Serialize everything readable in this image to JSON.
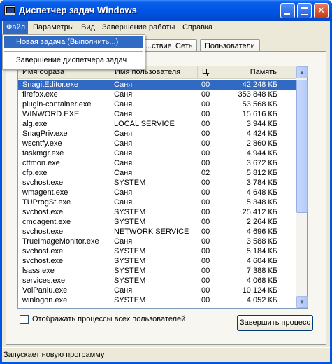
{
  "window": {
    "title": "Диспетчер задач Windows"
  },
  "menu": {
    "items": [
      "Файл",
      "Параметры",
      "Вид",
      "Завершение работы",
      "Справка"
    ],
    "file_dropdown": [
      "Новая задача (Выполнить...)",
      "Завершение диспетчера задач"
    ]
  },
  "tabs": [
    "...ствие",
    "Сеть",
    "Пользователи"
  ],
  "processes": {
    "columns": [
      "Имя образа",
      "Имя пользователя",
      "Ц.",
      "Память"
    ],
    "rows": [
      {
        "name": "SnagitEditor.exe",
        "user": "Саня",
        "cpu": "00",
        "mem": "42 248 КБ"
      },
      {
        "name": "firefox.exe",
        "user": "Саня",
        "cpu": "00",
        "mem": "353 848 КБ"
      },
      {
        "name": "plugin-container.exe",
        "user": "Саня",
        "cpu": "00",
        "mem": "53 568 КБ"
      },
      {
        "name": "WINWORD.EXE",
        "user": "Саня",
        "cpu": "00",
        "mem": "15 616 КБ"
      },
      {
        "name": "alg.exe",
        "user": "LOCAL SERVICE",
        "cpu": "00",
        "mem": "3 944 КБ"
      },
      {
        "name": "SnagPriv.exe",
        "user": "Саня",
        "cpu": "00",
        "mem": "4 424 КБ"
      },
      {
        "name": "wscntfy.exe",
        "user": "Саня",
        "cpu": "00",
        "mem": "2 860 КБ"
      },
      {
        "name": "taskmgr.exe",
        "user": "Саня",
        "cpu": "00",
        "mem": "4 944 КБ"
      },
      {
        "name": "ctfmon.exe",
        "user": "Саня",
        "cpu": "00",
        "mem": "3 672 КБ"
      },
      {
        "name": "cfp.exe",
        "user": "Саня",
        "cpu": "02",
        "mem": "5 812 КБ"
      },
      {
        "name": "svchost.exe",
        "user": "SYSTEM",
        "cpu": "00",
        "mem": "3 784 КБ"
      },
      {
        "name": "wmagent.exe",
        "user": "Саня",
        "cpu": "00",
        "mem": "4 648 КБ"
      },
      {
        "name": "TUProgSt.exe",
        "user": "Саня",
        "cpu": "00",
        "mem": "5 348 КБ"
      },
      {
        "name": "svchost.exe",
        "user": "SYSTEM",
        "cpu": "00",
        "mem": "25 412 КБ"
      },
      {
        "name": "cmdagent.exe",
        "user": "SYSTEM",
        "cpu": "00",
        "mem": "2 264 КБ"
      },
      {
        "name": "svchost.exe",
        "user": "NETWORK SERVICE",
        "cpu": "00",
        "mem": "4 696 КБ"
      },
      {
        "name": "TrueImageMonitor.exe",
        "user": "Саня",
        "cpu": "00",
        "mem": "3 588 КБ"
      },
      {
        "name": "svchost.exe",
        "user": "SYSTEM",
        "cpu": "00",
        "mem": "5 184 КБ"
      },
      {
        "name": "svchost.exe",
        "user": "SYSTEM",
        "cpu": "00",
        "mem": "4 604 КБ"
      },
      {
        "name": "lsass.exe",
        "user": "SYSTEM",
        "cpu": "00",
        "mem": "7 388 КБ"
      },
      {
        "name": "services.exe",
        "user": "SYSTEM",
        "cpu": "00",
        "mem": "4 068 КБ"
      },
      {
        "name": "VolPanlu.exe",
        "user": "Саня",
        "cpu": "00",
        "mem": "10 124 КБ"
      },
      {
        "name": "winlogon.exe",
        "user": "SYSTEM",
        "cpu": "00",
        "mem": "4 052 КБ"
      }
    ]
  },
  "show_all_label": "Отображать процессы всех пользователей",
  "end_process_label": "Завершить процесс",
  "status_text": "Запускает новую программу",
  "colors": {
    "titlebar": "#0054e3",
    "selection": "#316ac5",
    "face": "#ece9d8"
  }
}
